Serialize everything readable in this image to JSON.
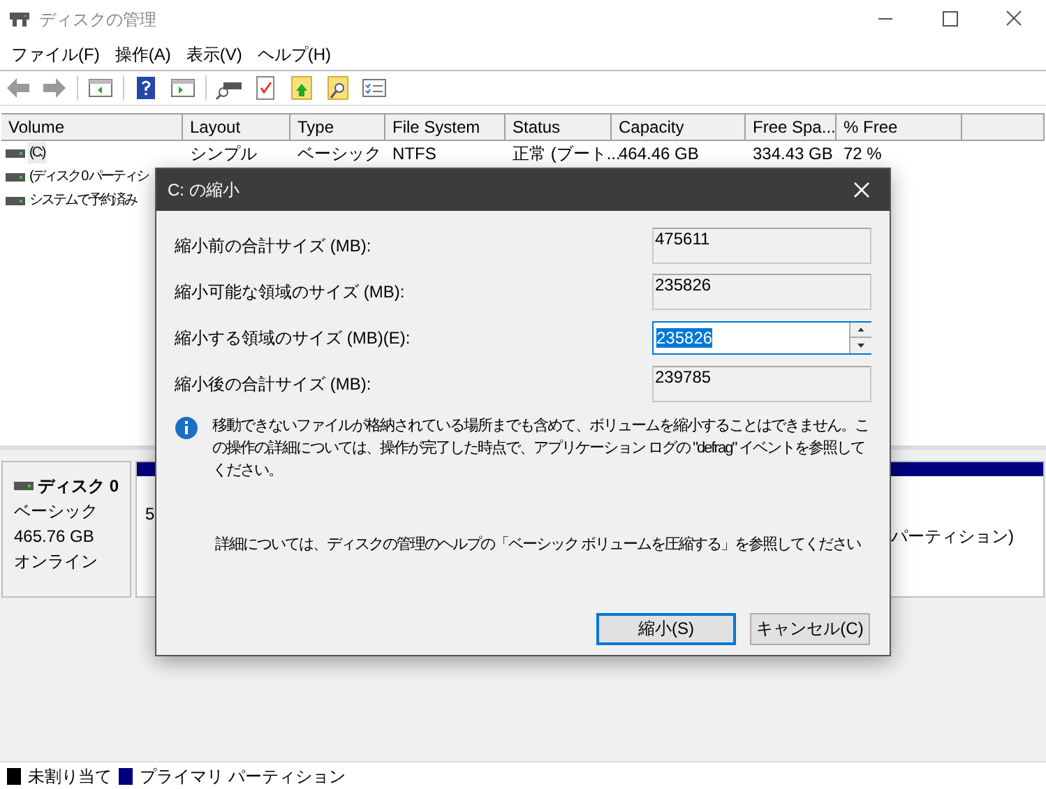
{
  "window": {
    "title": "ディスクの管理"
  },
  "menu": [
    "ファイル(F)",
    "操作(A)",
    "表示(V)",
    "ヘルプ(H)"
  ],
  "table": {
    "columns": [
      "Volume",
      "Layout",
      "Type",
      "File System",
      "Status",
      "Capacity",
      "Free Spa...",
      "% Free"
    ],
    "rows": [
      {
        "selected": true,
        "cells": [
          "(C:)",
          "シンプル",
          "ベーシック",
          "NTFS",
          "正常 (ブート...",
          "464.46 GB",
          "334.43 GB",
          "72 %"
        ]
      },
      {
        "selected": false,
        "cells": [
          "(ディスク 0 パーティシ"
        ]
      },
      {
        "selected": false,
        "cells": [
          "システムで予約済み"
        ]
      }
    ]
  },
  "disk": {
    "name": "ディスク 0",
    "type": "ベーシック",
    "size": "465.76 GB",
    "state": "オンライン",
    "partitions": [
      {
        "lines": [
          "5"
        ]
      },
      {
        "lines": [
          "パーティション)"
        ]
      }
    ]
  },
  "legend": [
    {
      "label": "未割り当て",
      "color": "#000000"
    },
    {
      "label": "プライマリ パーティション",
      "color": "#000080"
    }
  ],
  "dialog": {
    "title": "C: の縮小",
    "fields": [
      {
        "kind": "readonly",
        "label": "縮小前の合計サイズ (MB):",
        "value": "475611"
      },
      {
        "kind": "readonly",
        "label": "縮小可能な領域のサイズ (MB):",
        "value": "235826"
      },
      {
        "kind": "spin",
        "label": "縮小する領域のサイズ (MB)(E):",
        "value": "235826"
      },
      {
        "kind": "readonly",
        "label": "縮小後の合計サイズ (MB):",
        "value": "239785"
      }
    ],
    "info": "移動できないファイルが格納されている場所までも含めて、ボリュームを縮小することはできません。この操作の詳細については、操作が完了した時点で、アプリケーション ログの \"defrag\" イベントを参照してください。",
    "detail": "詳細については、ディスクの管理のヘルプの「ベーシック ボリュームを圧縮する」を参照してください",
    "buttons": [
      {
        "label": "縮小(S)",
        "default": true
      },
      {
        "label": "キャンセル(C)",
        "default": false
      }
    ]
  }
}
